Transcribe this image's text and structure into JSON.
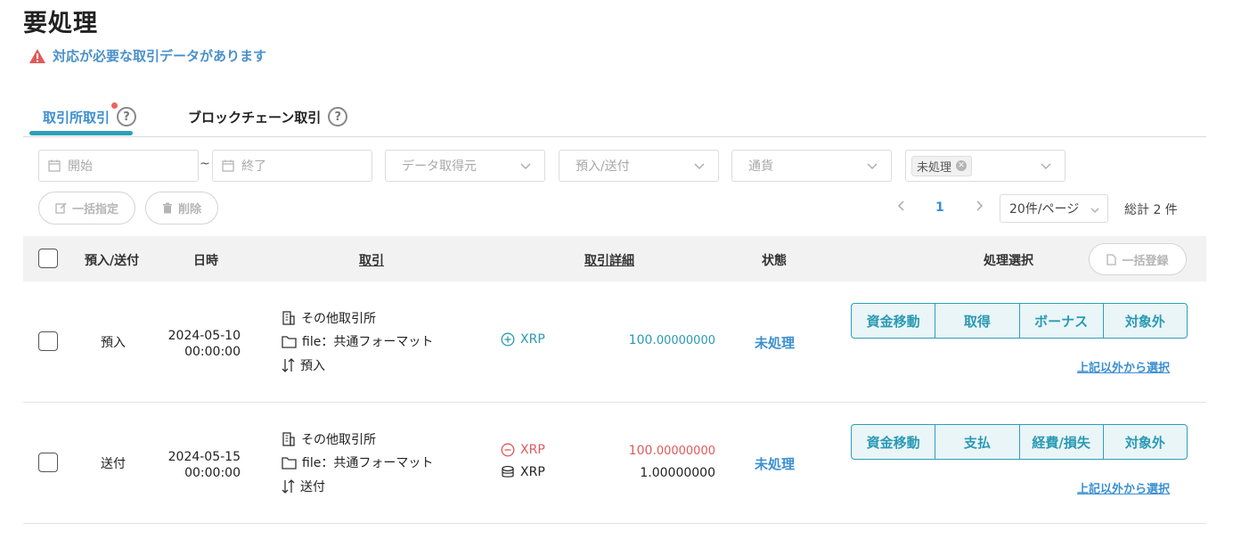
{
  "page": {
    "title": "要処理",
    "alert": "対応が必要な取引データがあります",
    "alert_color": "#e05a5a"
  },
  "tabs": [
    {
      "label": "取引所取引",
      "active": true,
      "has_notification": true
    },
    {
      "label": "ブロックチェーン取引",
      "active": false
    }
  ],
  "filters": {
    "start_placeholder": "開始",
    "end_placeholder": "終了",
    "range_separator": "~",
    "source_placeholder": "データ取得元",
    "direction_placeholder": "預入/送付",
    "currency_placeholder": "通貨",
    "status_tag": "未処理"
  },
  "actions": {
    "bulk_assign": "一括指定",
    "delete": "削除",
    "bulk_register": "一括登録"
  },
  "pagination": {
    "current_page": "1",
    "page_size": "20件/ページ",
    "total": "総計 2 件"
  },
  "table": {
    "columns": {
      "direction": "預入/送付",
      "datetime": "日時",
      "transaction": "取引",
      "detail": "取引詳細",
      "status": "状態",
      "action": "処理選択"
    },
    "rows": [
      {
        "direction": "預入",
        "date": "2024-05-10",
        "time": "00:00:00",
        "exchange": "その他取引所",
        "file": "file：共通フォーマット",
        "type": "預入",
        "asset1": {
          "symbol": "XRP",
          "sign": "plus",
          "int": "100.",
          "dec": "00000000",
          "color": "#2a9ab3"
        },
        "status": "未処理",
        "buttons": [
          "資金移動",
          "取得",
          "ボーナス",
          "対象外"
        ],
        "other_link": "上記以外から選択"
      },
      {
        "direction": "送付",
        "date": "2024-05-15",
        "time": "00:00:00",
        "exchange": "その他取引所",
        "file": "file：共通フォーマット",
        "type": "送付",
        "asset1": {
          "symbol": "XRP",
          "sign": "minus",
          "int": "100.",
          "dec": "00000000",
          "color": "#e05a5a"
        },
        "asset2": {
          "symbol": "XRP",
          "amount": "1.00000000"
        },
        "status": "未処理",
        "buttons": [
          "資金移動",
          "支払",
          "経費/損失",
          "対象外"
        ],
        "other_link": "上記以外から選択"
      }
    ]
  },
  "colors": {
    "accent": "#3b8fd0",
    "teal": "#2ba0b8",
    "danger": "#e05a5a"
  }
}
